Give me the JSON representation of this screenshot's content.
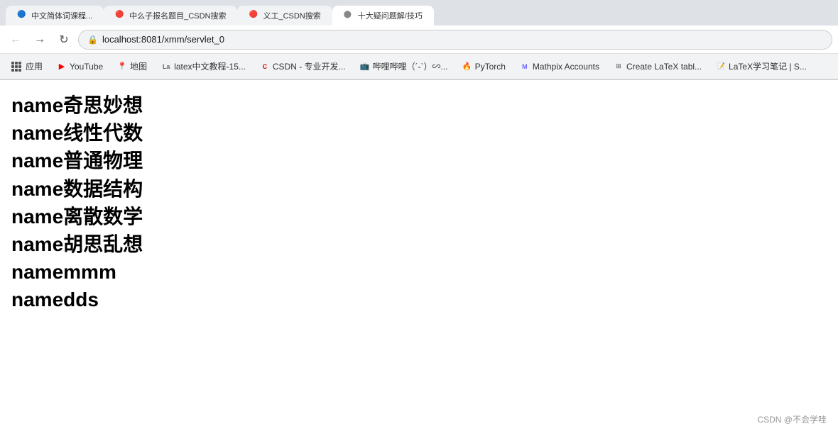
{
  "browser": {
    "tabs": [
      {
        "id": "tab1",
        "label": "中文简体词课程...",
        "active": false,
        "favicon": "●"
      },
      {
        "id": "tab2",
        "label": "中么子报名题目_CSDN搜索",
        "active": false,
        "favicon": "●"
      },
      {
        "id": "tab3",
        "label": "义工_CSDN搜索",
        "active": false,
        "favicon": "●"
      },
      {
        "id": "tab4",
        "label": "十大疑问题解/技巧",
        "active": true,
        "favicon": "●"
      }
    ],
    "address": "localhost:8081/xmm/servlet_0",
    "bookmarks": [
      {
        "id": "apps",
        "label": "应用",
        "type": "apps"
      },
      {
        "id": "youtube",
        "label": "YouTube",
        "color": "#ff0000"
      },
      {
        "id": "ditu",
        "label": "地图",
        "color": "#34a853"
      },
      {
        "id": "latex",
        "label": "latex中文教程-15...",
        "color": "#666"
      },
      {
        "id": "csdn",
        "label": "CSDN - 专业开发...",
        "color": "#c00"
      },
      {
        "id": "bilibili",
        "label": "哔哩哔哩（´-`）∽...",
        "color": "#fb7299"
      },
      {
        "id": "pytorch",
        "label": "PyTorch",
        "color": "#ee4c2c"
      },
      {
        "id": "mathpix",
        "label": "Mathpix Accounts",
        "color": "#6c63ff"
      },
      {
        "id": "createlatex",
        "label": "Create LaTeX tabl...",
        "color": "#666"
      },
      {
        "id": "latexnotes",
        "label": "LaTeX学习笔记 | S...",
        "color": "#555"
      }
    ]
  },
  "page": {
    "items": [
      {
        "id": "item1",
        "text": "name奇思妙想"
      },
      {
        "id": "item2",
        "text": "name线性代数"
      },
      {
        "id": "item3",
        "text": "name普通物理"
      },
      {
        "id": "item4",
        "text": "name数据结构"
      },
      {
        "id": "item5",
        "text": "name离散数学"
      },
      {
        "id": "item6",
        "text": "name胡思乱想"
      },
      {
        "id": "item7",
        "text": "namemmm"
      },
      {
        "id": "item8",
        "text": "namedds"
      }
    ],
    "watermark": "CSDN @不会学哇"
  }
}
